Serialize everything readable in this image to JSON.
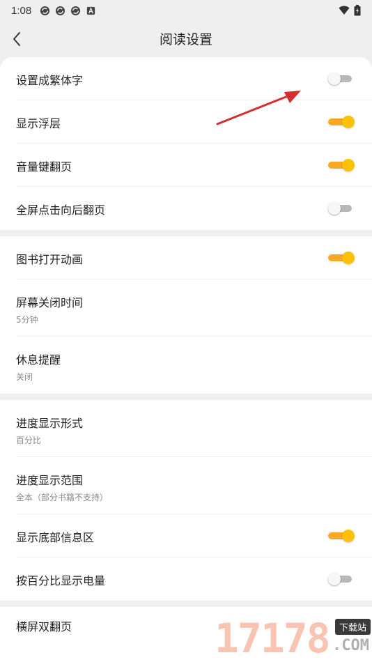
{
  "status_bar": {
    "time": "1:08",
    "notification_icons": [
      "sync-icon",
      "sync-icon",
      "sync-icon",
      "app-a-icon"
    ],
    "right_icons": [
      "wifi-icon",
      "battery-charging-icon"
    ]
  },
  "header": {
    "title": "阅读设置",
    "back_icon": "chevron-left-icon"
  },
  "colors": {
    "toggle_on": "#ffc107",
    "toggle_on_track": "#f9a825",
    "toggle_off_track": "#b8b8b8",
    "annotation_arrow": "#d32f2f",
    "background": "#efefef"
  },
  "sections": [
    {
      "items": [
        {
          "title": "设置成繁体字",
          "toggle": false
        },
        {
          "title": "显示浮层",
          "toggle": true
        },
        {
          "title": "音量键翻页",
          "toggle": true
        },
        {
          "title": "全屏点击向后翻页",
          "toggle": false
        }
      ]
    },
    {
      "items": [
        {
          "title": "图书打开动画",
          "toggle": true
        },
        {
          "title": "屏幕关闭时间",
          "subtitle": "5分钟"
        },
        {
          "title": "休息提醒",
          "subtitle": "关闭"
        }
      ]
    },
    {
      "items": [
        {
          "title": "进度显示形式",
          "subtitle": "百分比"
        },
        {
          "title": "进度显示范围",
          "subtitle": "全本（部分书籍不支持）"
        },
        {
          "title": "显示底部信息区",
          "toggle": true
        },
        {
          "title": "按百分比显示电量",
          "toggle": false
        }
      ]
    },
    {
      "items": [
        {
          "title": "横屏双翻页"
        }
      ]
    }
  ],
  "watermark": {
    "digits": "17178",
    "top_text": "下载站",
    "bottom_text": ".COM"
  }
}
